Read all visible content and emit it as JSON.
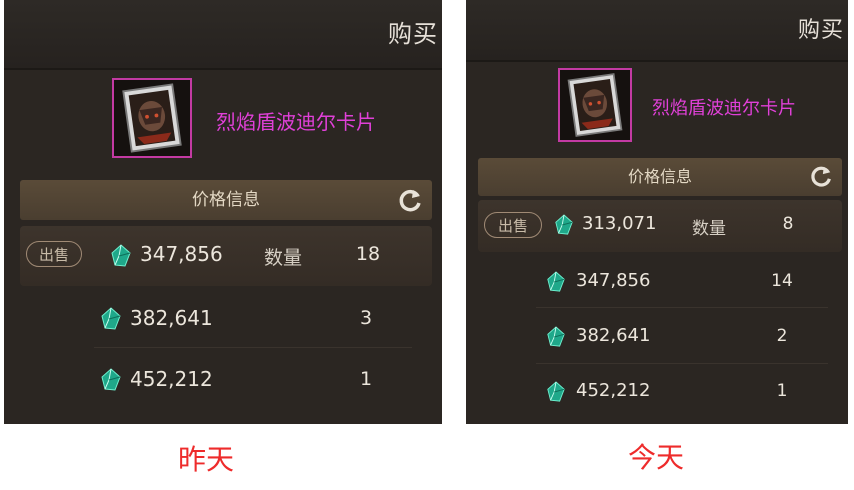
{
  "left": {
    "buy_label": "购买",
    "item_name": "烈焰盾波迪尔卡片",
    "price_header": "价格信息",
    "rows": [
      {
        "badge": "出售",
        "price": "347,856",
        "qty_label": "数量",
        "qty": "18"
      },
      {
        "price": "382,641",
        "qty": "3"
      },
      {
        "price": "452,212",
        "qty": "1"
      }
    ],
    "caption": "昨天"
  },
  "right": {
    "buy_label": "购买",
    "item_name": "烈焰盾波迪尔卡片",
    "price_header": "价格信息",
    "rows": [
      {
        "badge": "出售",
        "price": "313,071",
        "qty_label": "数量",
        "qty": "8"
      },
      {
        "price": "347,856",
        "qty": "14"
      },
      {
        "price": "382,641",
        "qty": "2"
      },
      {
        "price": "452,212",
        "qty": "1"
      }
    ],
    "caption": "今天"
  },
  "colors": {
    "item_name": "#e040d8",
    "caption": "#ee2b2b",
    "panel_bg": "#2b2622"
  }
}
